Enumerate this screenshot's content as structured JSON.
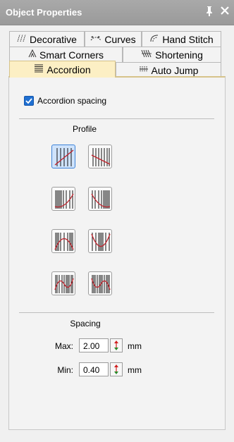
{
  "window": {
    "title": "Object Properties",
    "pin_glyph": "1",
    "close_glyph": "×"
  },
  "tabs": {
    "row1": [
      {
        "label": "Decorative",
        "icon": "decorative-icon"
      },
      {
        "label": "Curves",
        "icon": "curves-icon"
      },
      {
        "label": "Hand Stitch",
        "icon": "hand-stitch-icon"
      }
    ],
    "row2": [
      {
        "label": "Smart Corners",
        "icon": "smart-corners-icon"
      },
      {
        "label": "Shortening",
        "icon": "shortening-icon"
      }
    ],
    "row3": [
      {
        "label": "Accordion",
        "icon": "accordion-icon",
        "active": true
      },
      {
        "label": "Auto Jump",
        "icon": "auto-jump-icon"
      }
    ]
  },
  "accordion": {
    "checkbox_label": "Accordion spacing",
    "checked": true,
    "profile_title": "Profile",
    "profiles": [
      {
        "name": "linear-up",
        "selected": true
      },
      {
        "name": "linear-down",
        "selected": false
      },
      {
        "name": "curve-up",
        "selected": false
      },
      {
        "name": "curve-down",
        "selected": false
      },
      {
        "name": "arch-peak",
        "selected": false
      },
      {
        "name": "arch-dip",
        "selected": false
      },
      {
        "name": "wave-1",
        "selected": false
      },
      {
        "name": "wave-2",
        "selected": false
      }
    ],
    "spacing_title": "Spacing",
    "max_label": "Max:",
    "max_value": "2.00",
    "min_label": "Min:",
    "min_value": "0.40",
    "unit": "mm"
  },
  "colors": {
    "active_tab": "#fcefc4",
    "checkbox": "#1f6fd1",
    "selection": "#cfe3fb",
    "curve": "#c0202a",
    "spin_up": "#d02020",
    "spin_down": "#2a8a2a"
  }
}
